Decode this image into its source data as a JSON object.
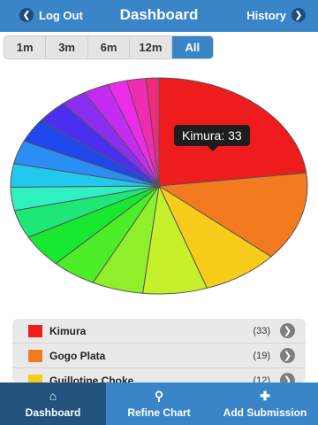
{
  "header": {
    "title": "Dashboard",
    "left_label": "Log Out",
    "right_label": "History"
  },
  "segments": [
    "1m",
    "3m",
    "6m",
    "12m",
    "All"
  ],
  "tooltip": "Kimura: 33",
  "legend": [
    {
      "name": "Kimura",
      "count": "(33)",
      "color": "#ee1c1c"
    },
    {
      "name": "Gogo Plata",
      "count": "(19)",
      "color": "#f47a20"
    },
    {
      "name": "Guillotine Choke",
      "count": "(12)",
      "color": "#f8cc1b"
    }
  ],
  "tabs": [
    {
      "label": "Dashboard",
      "icon": "home-icon"
    },
    {
      "label": "Refine Chart",
      "icon": "search-icon"
    },
    {
      "label": "Add Submission",
      "icon": "plus-icon"
    }
  ],
  "chart_data": {
    "type": "pie",
    "values": [
      33,
      19,
      12,
      10,
      8,
      7,
      7,
      6,
      5,
      5,
      5,
      5,
      5,
      4,
      4,
      3,
      3,
      2
    ],
    "colors": [
      "#ee1c1c",
      "#f47a20",
      "#f8cc1b",
      "#c6f02a",
      "#8fef2a",
      "#4ded29",
      "#18e830",
      "#1de777",
      "#2ef0c0",
      "#21c9ef",
      "#2a8ef5",
      "#1f48ec",
      "#4a2ff0",
      "#8a2ff0",
      "#c32bf0",
      "#ef2bea",
      "#ef2bb0",
      "#ef2b78"
    ],
    "labels": [
      "Kimura",
      "Gogo Plata",
      "Guillotine Choke"
    ]
  }
}
